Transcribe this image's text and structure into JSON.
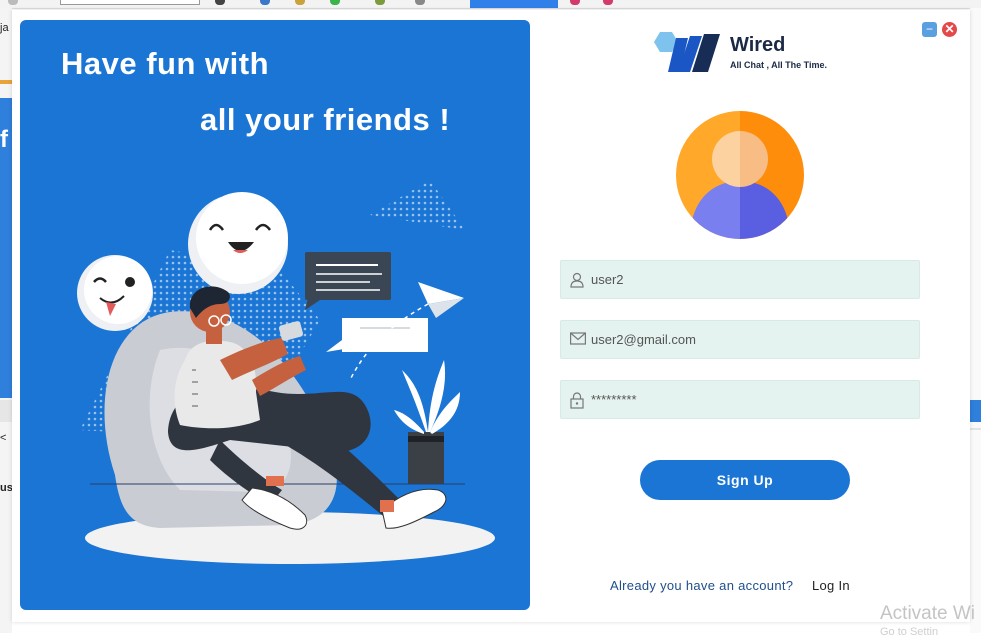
{
  "app": {
    "logo_name": "Wired",
    "logo_tagline": "All Chat , All The Time."
  },
  "hero": {
    "line1": "Have fun with",
    "line2": "all your friends !"
  },
  "form": {
    "username": {
      "value": "user2",
      "icon": "user-icon"
    },
    "email": {
      "value": "user2@gmail.com",
      "icon": "envelope-icon"
    },
    "password": {
      "value": "*********",
      "icon": "lock-icon"
    },
    "signup_label": "Sign Up",
    "already_text": "Already you have an account?",
    "login_label": "Log In"
  },
  "window_controls": {
    "minimize": "−",
    "close": "✕"
  },
  "background": {
    "left_fragments": [
      "ja",
      "f",
      "<",
      "us"
    ],
    "watermark_line1": "Activate Wi",
    "watermark_line2": "Go to Settin"
  },
  "colors": {
    "primary": "#1a75d4",
    "field_bg": "#e4f3ef",
    "logo_dark": "#1a2a44",
    "close": "#e54848",
    "minimize": "#5aa0e0",
    "avatar_orange": "#ff9f1a",
    "avatar_purple": "#6b6ee8"
  }
}
